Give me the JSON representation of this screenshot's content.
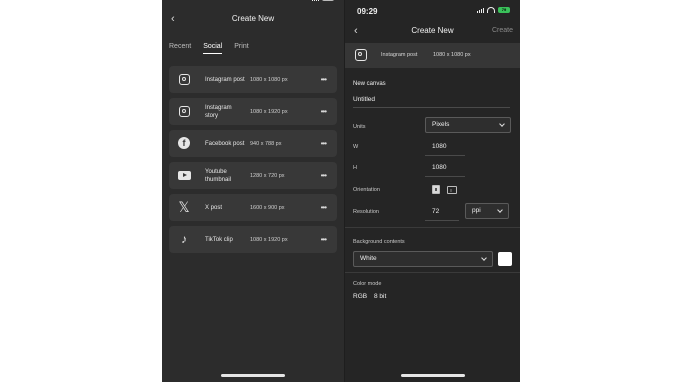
{
  "left_screen": {
    "nav": {
      "back_icon": "chevron-left-icon",
      "title": "Create New"
    },
    "tabs": [
      {
        "label": "Recent",
        "active": false
      },
      {
        "label": "Social",
        "active": true
      },
      {
        "label": "Print",
        "active": false
      }
    ],
    "presets": [
      {
        "icon": "instagram-icon",
        "name": "Instagram post",
        "size": "1080 x 1080 px"
      },
      {
        "icon": "instagram-icon",
        "name": "Instagram story",
        "size": "1080 x 1920 px"
      },
      {
        "icon": "facebook-icon",
        "name": "Facebook post",
        "size": "940 x 788 px"
      },
      {
        "icon": "youtube-icon",
        "name": "Youtube thumbnail",
        "size": "1280 x 720 px"
      },
      {
        "icon": "x-icon",
        "name": "X post",
        "size": "1600 x 900 px"
      },
      {
        "icon": "tiktok-icon",
        "name": "TikTok clip",
        "size": "1080 x 1920 px"
      }
    ],
    "more_label": "•••"
  },
  "right_screen": {
    "status": {
      "time": "09:29",
      "battery": "79"
    },
    "nav": {
      "back_icon": "chevron-left-icon",
      "title": "Create New",
      "action": "Create"
    },
    "selected_preset": {
      "icon": "instagram-icon",
      "name": "Instagram post",
      "size": "1080 x 1080 px"
    },
    "canvas": {
      "section_label": "New canvas",
      "name": "Untitled",
      "units_label": "Units",
      "units_value": "Pixels",
      "w_label": "W",
      "w_value": "1080",
      "h_label": "H",
      "h_value": "1080",
      "orientation_label": "Orientation",
      "resolution_label": "Resolution",
      "resolution_value": "72",
      "resolution_unit": "ppi",
      "background_label": "Background contents",
      "background_value": "White",
      "background_swatch": "#ffffff",
      "color_mode_label": "Color mode",
      "color_mode_value": "RGB",
      "bit_depth": "8 bit"
    }
  },
  "colors": {
    "screen_bg": "#2c2c2c",
    "card_bg": "#383838",
    "battery_green": "#3ac15a"
  }
}
